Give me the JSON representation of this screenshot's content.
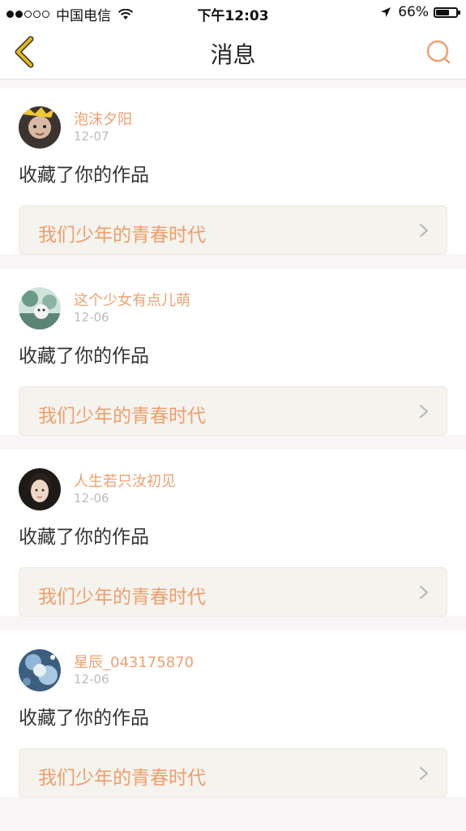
{
  "status_bar": {
    "carrier": "中国电信",
    "time": "下午12:03",
    "battery": "66%",
    "battery_level": 0.66,
    "signal_bars": 2,
    "signal_total": 5
  },
  "nav": {
    "title": "消息",
    "back_icon": "chevron-left-icon",
    "search_icon": "search-icon"
  },
  "colors": {
    "accent": "#f0a070",
    "back_icon": "#e6b820",
    "link_bg": "#f4f3ee"
  },
  "messages": [
    {
      "username": "泡沫夕阳",
      "date": "12-07",
      "action": "收藏了你的作品",
      "work": "我们少年的青春时代"
    },
    {
      "username": "这个少女有点儿萌",
      "date": "12-06",
      "action": "收藏了你的作品",
      "work": "我们少年的青春时代"
    },
    {
      "username": "人生若只汝初见",
      "date": "12-06",
      "action": "收藏了你的作品",
      "work": "我们少年的青春时代"
    },
    {
      "username": "星辰_043175870",
      "date": "12-06",
      "action": "收藏了你的作品",
      "work": "我们少年的青春时代"
    }
  ]
}
